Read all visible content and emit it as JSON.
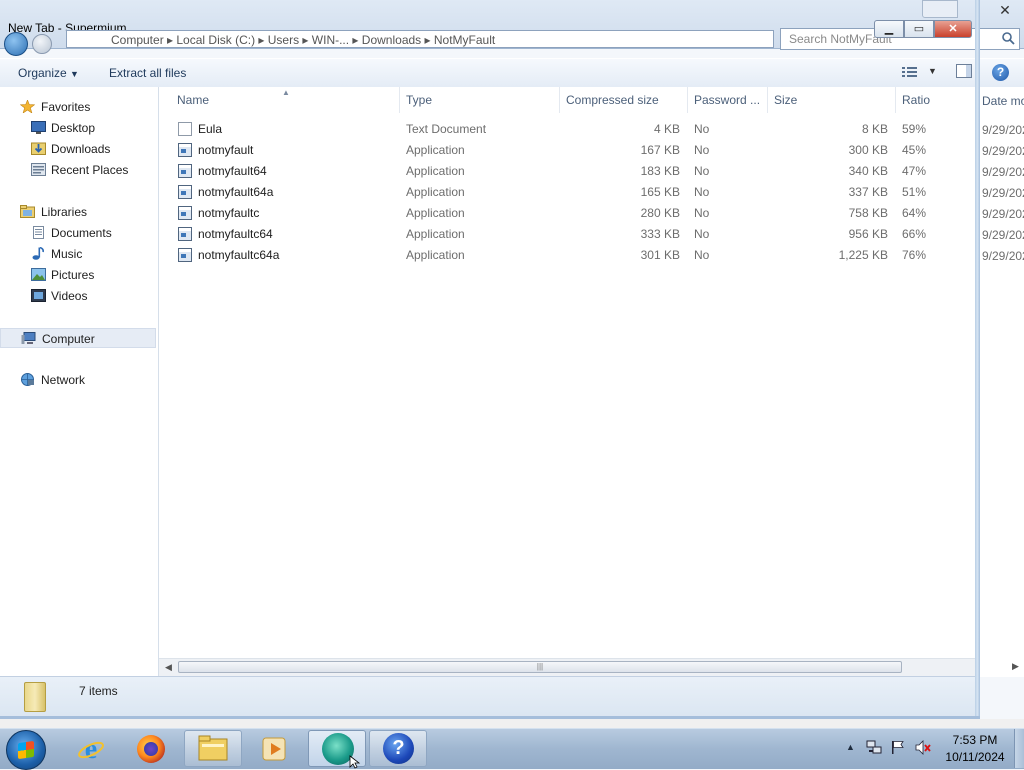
{
  "background_window": {
    "title": "New Tab - Supermium"
  },
  "address": {
    "path": "Computer  ▸  Local Disk (C:)  ▸  Users  ▸  WIN-... ▸  Downloads  ▸  NotMyFault",
    "search_placeholder": "Search NotMyFault"
  },
  "toolbar": {
    "organize_label": "Organize",
    "extract_label": "Extract all files"
  },
  "navigation": {
    "favorites": {
      "label": "Favorites",
      "items": [
        {
          "label": "Desktop",
          "icon": "desktop-icon"
        },
        {
          "label": "Downloads",
          "icon": "downloads-icon"
        },
        {
          "label": "Recent Places",
          "icon": "recent-places-icon"
        }
      ]
    },
    "libraries": {
      "label": "Libraries",
      "items": [
        {
          "label": "Documents",
          "icon": "documents-icon"
        },
        {
          "label": "Music",
          "icon": "music-icon"
        },
        {
          "label": "Pictures",
          "icon": "pictures-icon"
        },
        {
          "label": "Videos",
          "icon": "videos-icon"
        }
      ]
    },
    "computer": {
      "label": "Computer"
    },
    "network": {
      "label": "Network"
    }
  },
  "columns": {
    "name": "Name",
    "type": "Type",
    "compressed": "Compressed size",
    "password": "Password ...",
    "size": "Size",
    "ratio": "Ratio",
    "date": "Date mo"
  },
  "files": [
    {
      "name": "Eula",
      "type": "Text Document",
      "compressed": "4 KB",
      "password": "No",
      "size": "8 KB",
      "ratio": "59%",
      "date": "9/29/202"
    },
    {
      "name": "notmyfault",
      "type": "Application",
      "compressed": "167 KB",
      "password": "No",
      "size": "300 KB",
      "ratio": "45%",
      "date": "9/29/202"
    },
    {
      "name": "notmyfault64",
      "type": "Application",
      "compressed": "183 KB",
      "password": "No",
      "size": "340 KB",
      "ratio": "47%",
      "date": "9/29/202"
    },
    {
      "name": "notmyfault64a",
      "type": "Application",
      "compressed": "165 KB",
      "password": "No",
      "size": "337 KB",
      "ratio": "51%",
      "date": "9/29/202"
    },
    {
      "name": "notmyfaultc",
      "type": "Application",
      "compressed": "280 KB",
      "password": "No",
      "size": "758 KB",
      "ratio": "64%",
      "date": "9/29/202"
    },
    {
      "name": "notmyfaultc64",
      "type": "Application",
      "compressed": "333 KB",
      "password": "No",
      "size": "956 KB",
      "ratio": "66%",
      "date": "9/29/202"
    },
    {
      "name": "notmyfaultc64a",
      "type": "Application",
      "compressed": "301 KB",
      "password": "No",
      "size": "1,225 KB",
      "ratio": "76%",
      "date": "9/29/202"
    }
  ],
  "status": {
    "item_count": "7 items"
  },
  "taskbar": {
    "apps": [
      "internet-explorer-icon",
      "firefox-icon",
      "windows-explorer-icon",
      "media-player-icon",
      "supermium-browser-icon",
      "help-and-support-icon"
    ]
  },
  "clock": {
    "time": "7:53 PM",
    "date": "10/11/2024"
  }
}
